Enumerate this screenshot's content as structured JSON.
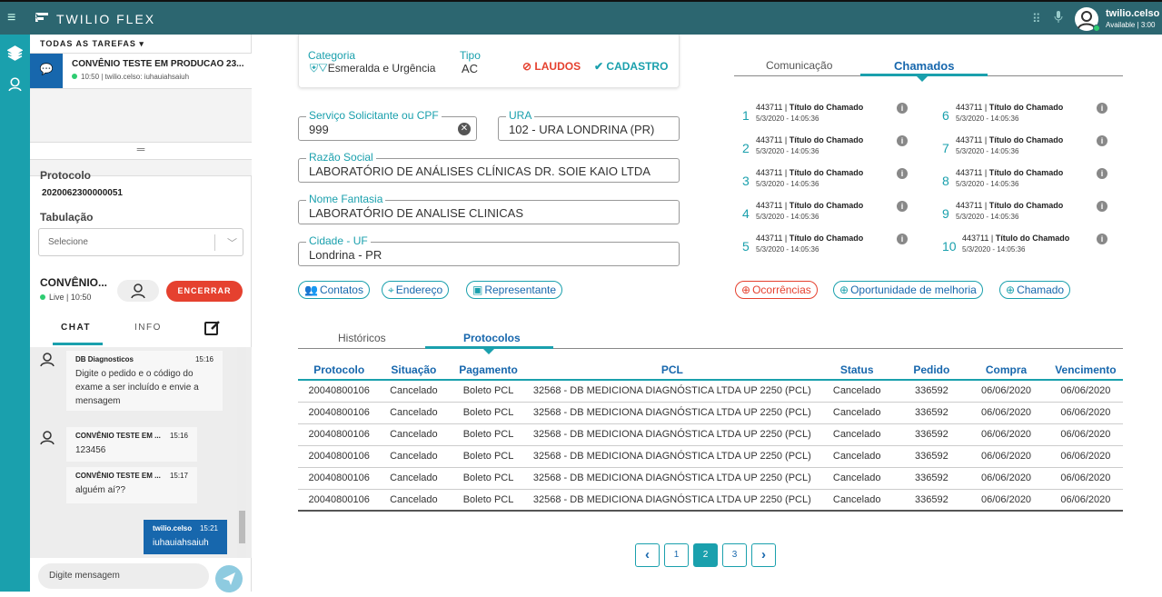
{
  "topbar": {
    "menu": "≡",
    "title": "TWILIO FLEX",
    "user": "twilio.celso",
    "status": "Available | 3:00"
  },
  "left": {
    "tasks_header": "TODAS AS TAREFAS",
    "task": {
      "title": "CONVÊNIO TESTE EM PRODUCAO 23...",
      "sub": "10:50 | twilio.celso: iuhauiahsaiuh"
    },
    "drag": "═",
    "protocolo_label": "Protocolo",
    "protocolo_value": "2020062300000051",
    "tabulacao_label": "Tabulação",
    "select_placeholder": "Selecione",
    "conv_title": "CONVÊNIO...",
    "conv_sub": "Live | 10:50",
    "encerrar": "ENCERRAR",
    "tabs": [
      "CHAT",
      "INFO"
    ],
    "messages": [
      {
        "name": "DB Diagnosticos",
        "time": "15:16",
        "text": "Digite o pedido e o código do exame a ser incluído e envie a mensagem"
      },
      {
        "name": "CONVÊNIO TESTE EM ...",
        "time": "15:16",
        "text": "123456"
      },
      {
        "name": "CONVÊNIO TESTE EM ...",
        "time": "15:17",
        "text": "alguém aí??"
      },
      {
        "name": "twilio.celso",
        "time": "15:21",
        "text": "iuhauiahsaiuh"
      }
    ],
    "input_placeholder": "Digite mensagem"
  },
  "form": {
    "categoria_label": "Categoria",
    "categoria_value": "Esmeralda e Urgência",
    "tipo_label": "Tipo",
    "tipo_value": "AC",
    "laudos": "LAUDOS",
    "cadastro": "CADASTRO",
    "servico_label": "Serviço Solicitante ou CPF",
    "servico_value": "999",
    "ura_label": "URA",
    "ura_value": "102 - URA LONDRINA (PR)",
    "razao_label": "Razão Social",
    "razao_value": "LABORATÓRIO DE ANÁLISES CLÍNICAS DR. SOIE KAIO LTDA",
    "fantasia_label": "Nome Fantasia",
    "fantasia_value": "LABORATÓRIO DE ANALISE CLINICAS",
    "cidade_label": "Cidade - UF",
    "cidade_value": "Londrina - PR",
    "buttons": [
      "Contatos",
      "Endereço",
      "Representante"
    ]
  },
  "right": {
    "tabs": [
      "Comunicação",
      "Chamados"
    ],
    "chamado_id": "443711",
    "chamado_title": "Título do Chamado",
    "chamado_date": "5/3/2020 - 14:05:36",
    "numbers": [
      "1",
      "2",
      "3",
      "4",
      "5",
      "6",
      "7",
      "8",
      "9",
      "10"
    ],
    "buttons": [
      "Ocorrências",
      "Oportunidade de melhoria",
      "Chamado"
    ]
  },
  "table": {
    "tabs": [
      "Históricos",
      "Protocolos"
    ],
    "headers": [
      "Protocolo",
      "Situação",
      "Pagamento",
      "PCL",
      "Status",
      "Pedido",
      "Compra",
      "Vencimento"
    ],
    "row": [
      "20040800106",
      "Cancelado",
      "Boleto PCL",
      "32568 - DB MEDICIONA DIAGNÓSTICA LTDA UP 2250 (PCL)",
      "Cancelado",
      "336592",
      "06/06/2020",
      "06/06/2020"
    ]
  },
  "pagination": {
    "prev": "‹",
    "pages": [
      "1",
      "2",
      "3"
    ],
    "active": "2",
    "next": "›"
  },
  "colors": {
    "topbar": "#2c6670",
    "rail": "#1aa0ad",
    "accent": "#1aa0ad",
    "primary": "#1767ad",
    "danger": "#e5412f"
  }
}
